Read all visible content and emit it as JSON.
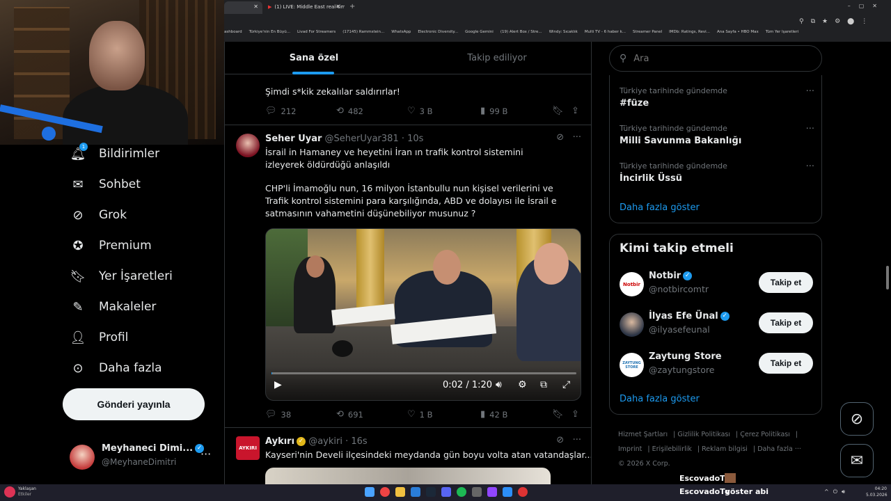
{
  "browser": {
    "tabs": [
      {
        "label": ""
      },
      {
        "label": "(1) LIVE: Middle East real-time ·"
      }
    ],
    "bookmarks": [
      "ashboard",
      "Türkiye'nin En Büyü...",
      "Livad For Streamers",
      "(17145) Rammstein...",
      "WhatsApp",
      "Electronic Diversity...",
      "Google Gemini",
      "(19) Alert Box / Stre...",
      "Windy: Sıcaklık",
      "Multi TV - 6 haber k...",
      "Streamer Panel",
      "IMDb: Ratings, Revi...",
      "Ana Sayfa • HBO Max",
      "Tüm Yer İşaretleri"
    ]
  },
  "sidebar": {
    "items": [
      {
        "label": "Bildirimler",
        "icon": "bell-icon",
        "badge": "1"
      },
      {
        "label": "Sohbet",
        "icon": "mail-icon"
      },
      {
        "label": "Grok",
        "icon": "grok-icon"
      },
      {
        "label": "Premium",
        "icon": "verified-badge-icon"
      },
      {
        "label": "Yer İşaretleri",
        "icon": "bookmark-icon"
      },
      {
        "label": "Makaleler",
        "icon": "article-icon"
      },
      {
        "label": "Profil",
        "icon": "person-icon"
      },
      {
        "label": "Daha fazla",
        "icon": "more-circle-icon"
      }
    ],
    "post_button": "Gönderi yayınla",
    "profile": {
      "name": "Meyhaneci Dimi...",
      "handle": "@MeyhaneDimitri"
    }
  },
  "feed": {
    "tabs": [
      {
        "label": "Sana özel"
      },
      {
        "label": "Takip ediliyor"
      }
    ],
    "tweet0": {
      "text": "Şimdi s*kik zekalılar saldırırlar!",
      "replies": "212",
      "retweets": "482",
      "likes": "3 B",
      "views": "99 B"
    },
    "tweet1": {
      "name": "Seher Uyar",
      "handle": "@SeherUyar381 · 10s",
      "text1": "İsrail in Hamaney ve heyetini İran ın trafik kontrol sistemini izleyerek öldürdüğü anlaşıldı",
      "text2": "CHP'li İmamoğlu nun, 16 milyon İstanbullu nun kişisel verilerini ve Trafik kontrol sistemini para karşılığında, ABD ve dolayısı ile İsrail e satmasının vahametini düşünebiliyor musunuz ?",
      "video_time": "0:02 / 1:20",
      "replies": "38",
      "retweets": "691",
      "likes": "1 B",
      "views": "42 B"
    },
    "tweet2": {
      "name": "Aykırı",
      "handle": "@aykiri · 16s",
      "text": "Kayseri'nin Develi ilçesindeki meydanda gün boyu volta atan vatandaşlar...",
      "avatar_text": "AYKIRI"
    }
  },
  "right": {
    "search_placeholder": "Ara",
    "trends": [
      {
        "context": "Türkiye tarihinde gündemde",
        "topic": "#füze"
      },
      {
        "context": "Türkiye tarihinde gündemde",
        "topic": "Milli Savunma Bakanlığı"
      },
      {
        "context": "Türkiye tarihinde gündemde",
        "topic": "İncirlik Üssü"
      }
    ],
    "show_more": "Daha fazla göster",
    "who_to_follow": {
      "title": "Kimi takip etmeli",
      "accounts": [
        {
          "name": "Notbir",
          "handle": "@notbircomtr",
          "button": "Takip et",
          "avatar_text": "Notbir"
        },
        {
          "name": "İlyas Efe Ünal",
          "handle": "@ilyasefeunal",
          "button": "Takip et"
        },
        {
          "name": "Zaytung Store",
          "handle": "@zaytungstore",
          "button": "Takip et",
          "avatar_text": "ZAYTUNG STORE"
        }
      ],
      "show_more": "Daha fazla göster"
    },
    "footer": {
      "links": [
        "Hizmet Şartları",
        "Gizlilik Politikası",
        "Çerez Politikası",
        "Imprint",
        "Erişilebilirlik",
        "Reklam bilgisi",
        "Daha fazla ···"
      ],
      "copyright": "© 2026 X Corp."
    }
  },
  "overlay": {
    "stream_name_1": "EscovadoTv",
    "stream_name_2": "EscovadoTv",
    "stream_message": "göster abi"
  },
  "taskbar": {
    "weather_title": "Yaklaşan",
    "weather_sub": "Etkiler",
    "time": "04:20",
    "date": "5.03.2026"
  },
  "colors": {
    "accent": "#1d9bf0",
    "bg": "#000000",
    "border": "#2f3336",
    "muted": "#71767b"
  }
}
